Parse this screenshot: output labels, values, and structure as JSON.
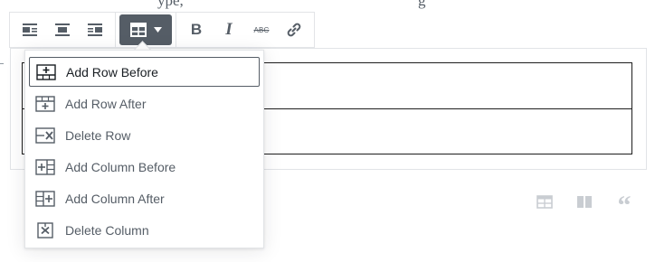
{
  "background_text": {
    "left": "ype,",
    "right": "g"
  },
  "toolbar": {
    "groups": [
      {
        "buttons": [
          {
            "icon": "align-left-icon",
            "name": "align-left-button"
          },
          {
            "icon": "align-center-icon",
            "name": "align-center-button"
          },
          {
            "icon": "align-right-icon",
            "name": "align-right-button"
          }
        ]
      },
      {
        "buttons": [
          {
            "icon": "table-edit-icon",
            "name": "edit-table-button",
            "active": true
          }
        ]
      },
      {
        "buttons": [
          {
            "icon": "bold-icon",
            "name": "bold-button",
            "label": "B"
          },
          {
            "icon": "italic-icon",
            "name": "italic-button",
            "label": "I"
          },
          {
            "icon": "strikethrough-icon",
            "name": "strikethrough-button",
            "label": "ABC"
          },
          {
            "icon": "link-icon",
            "name": "link-button"
          }
        ]
      }
    ]
  },
  "menu": {
    "items": [
      {
        "label": "Add Row Before",
        "icon": "add-row-before-icon",
        "focused": true
      },
      {
        "label": "Add Row After",
        "icon": "add-row-after-icon"
      },
      {
        "label": "Delete Row",
        "icon": "delete-row-icon"
      },
      {
        "label": "Add Column Before",
        "icon": "add-column-before-icon"
      },
      {
        "label": "Add Column After",
        "icon": "add-column-after-icon"
      },
      {
        "label": "Delete Column",
        "icon": "delete-column-icon"
      }
    ]
  },
  "side_icons": [
    {
      "icon": "table-icon"
    },
    {
      "icon": "columns-icon"
    },
    {
      "icon": "quote-icon",
      "glyph": "“"
    }
  ],
  "colors": {
    "toolbar_icon": "#555d66",
    "active_button_bg": "#555d66",
    "border": "#e2e4e7",
    "side_icon": "#c9cdd2"
  }
}
